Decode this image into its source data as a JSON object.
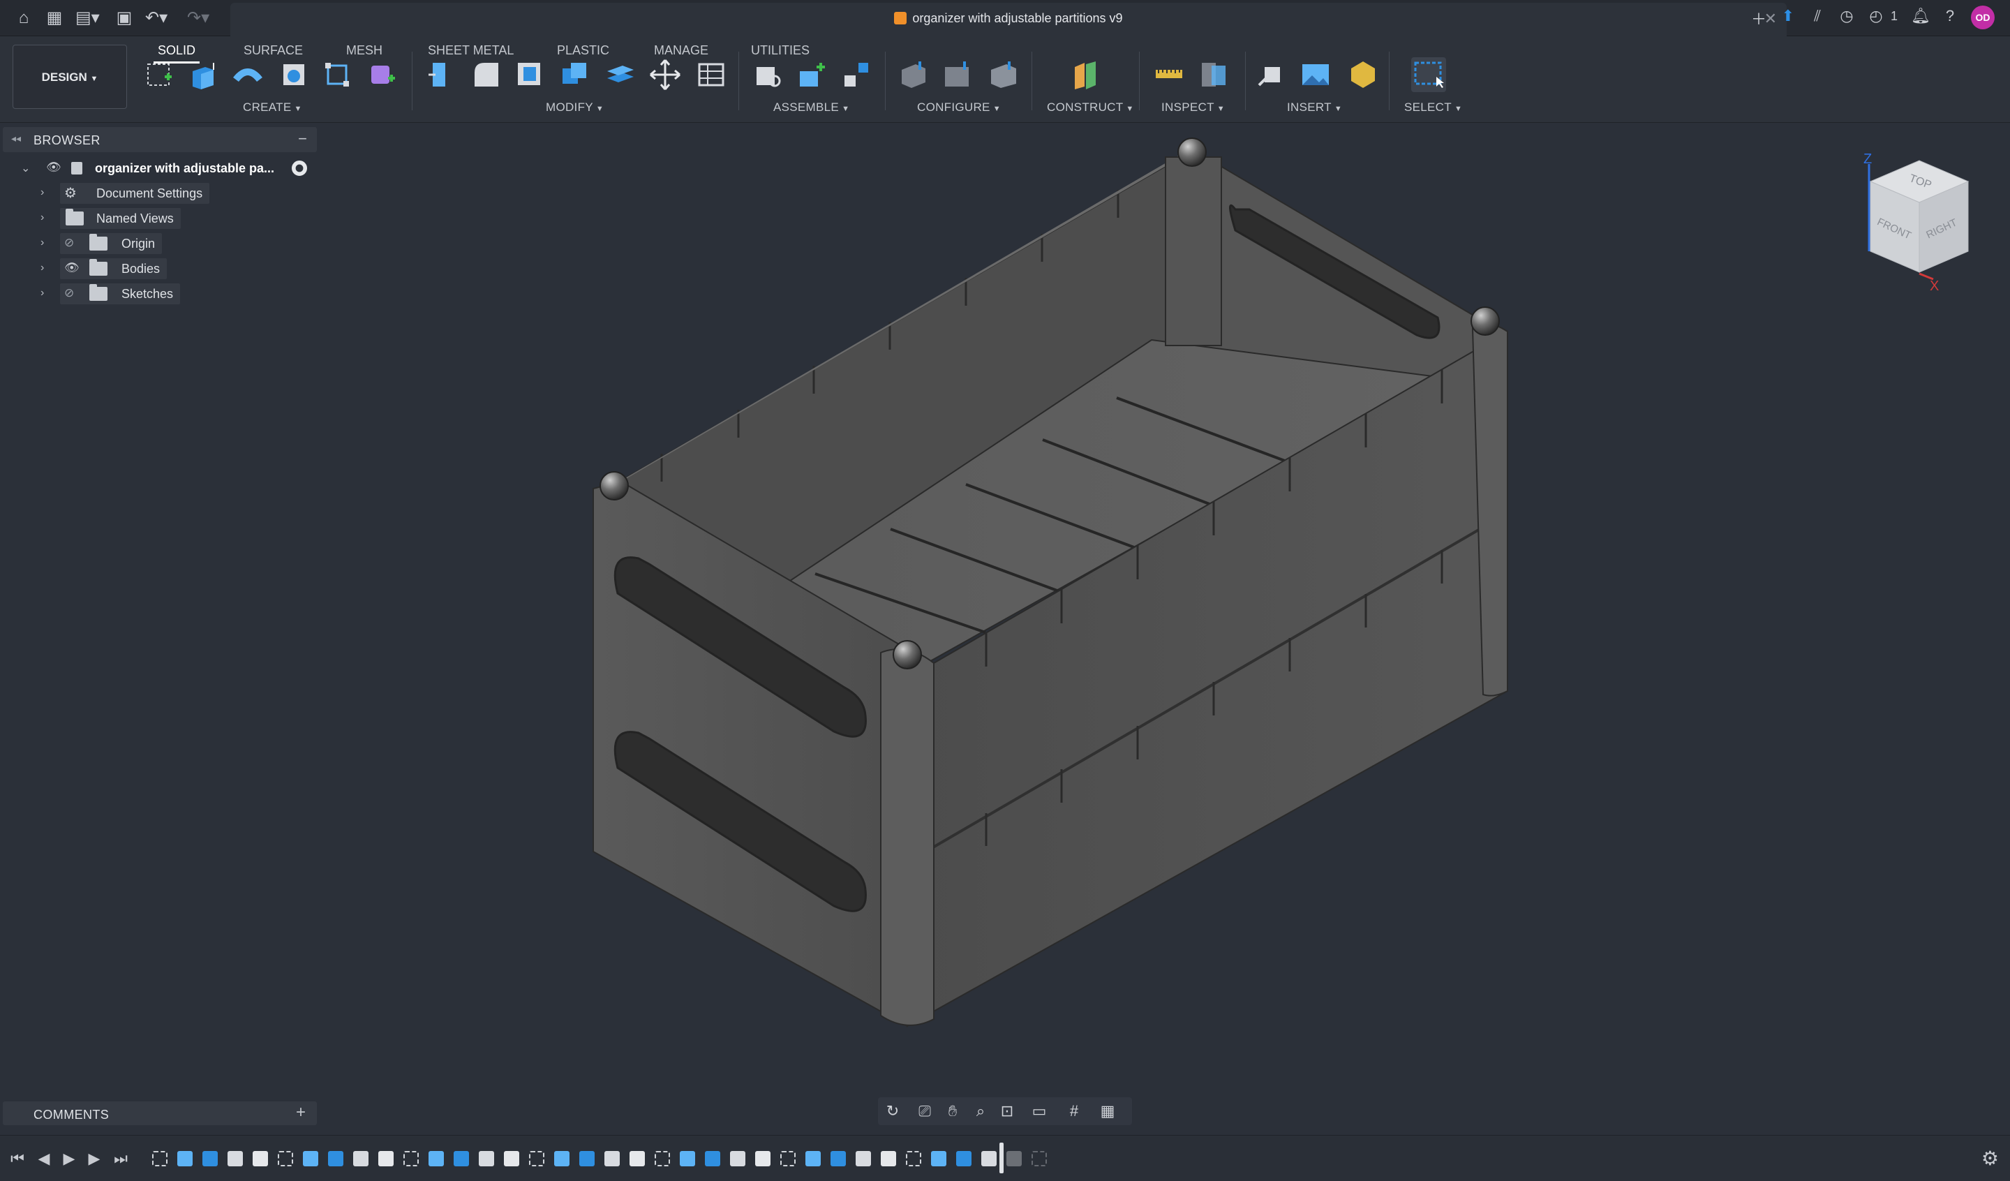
{
  "app": {
    "document_title": "organizer with adjustable partitions v9",
    "notifications_count": "1",
    "user_initials": "OD"
  },
  "workspace": {
    "mode_label": "DESIGN",
    "tabs": [
      "SOLID",
      "SURFACE",
      "MESH",
      "SHEET METAL",
      "PLASTIC",
      "MANAGE",
      "UTILITIES"
    ],
    "active_tab": "SOLID",
    "groups": [
      "CREATE",
      "MODIFY",
      "ASSEMBLE",
      "CONFIGURE",
      "CONSTRUCT",
      "INSPECT",
      "INSERT",
      "SELECT"
    ]
  },
  "browser": {
    "title": "BROWSER",
    "root": "organizer with adjustable pa...",
    "items": [
      "Document Settings",
      "Named Views",
      "Origin",
      "Bodies",
      "Sketches"
    ]
  },
  "comments": {
    "title": "COMMENTS"
  },
  "viewcube": {
    "faces": [
      "TOP",
      "FRONT",
      "RIGHT"
    ],
    "axes": [
      "Z",
      "X"
    ]
  },
  "colors": {
    "accent": "#1e88e5",
    "avatar": "#c22ea6",
    "model": "#585858",
    "viewport": "#2b3039"
  }
}
